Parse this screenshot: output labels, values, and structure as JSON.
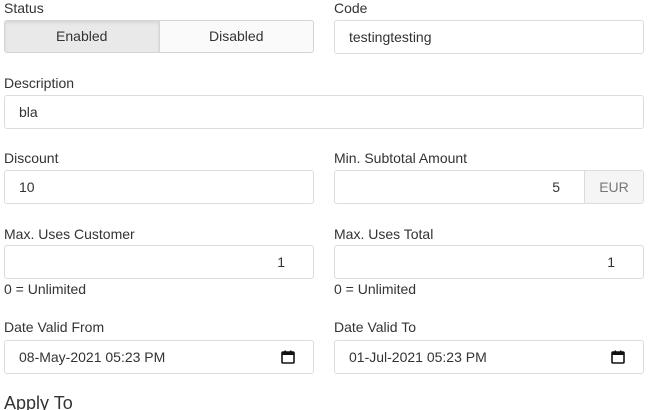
{
  "status": {
    "label": "Status",
    "options": [
      "Enabled",
      "Disabled"
    ],
    "selected": "Enabled"
  },
  "code": {
    "label": "Code",
    "value": "testingtesting"
  },
  "description": {
    "label": "Description",
    "value": "bla"
  },
  "discount": {
    "label": "Discount",
    "value": "10"
  },
  "min_subtotal": {
    "label": "Min. Subtotal Amount",
    "value": "5",
    "currency": "EUR"
  },
  "max_uses_customer": {
    "label": "Max. Uses Customer",
    "value": "1",
    "help": "0 = Unlimited"
  },
  "max_uses_total": {
    "label": "Max. Uses Total",
    "value": "1",
    "help": "0 = Unlimited"
  },
  "date_valid_from": {
    "label": "Date Valid From",
    "value": "08-May-2021 05:23 PM",
    "icon": "calendar-icon"
  },
  "date_valid_to": {
    "label": "Date Valid To",
    "value": "01-Jul-2021 05:23 PM",
    "icon": "calendar-icon"
  },
  "apply_to": {
    "heading": "Apply To"
  }
}
